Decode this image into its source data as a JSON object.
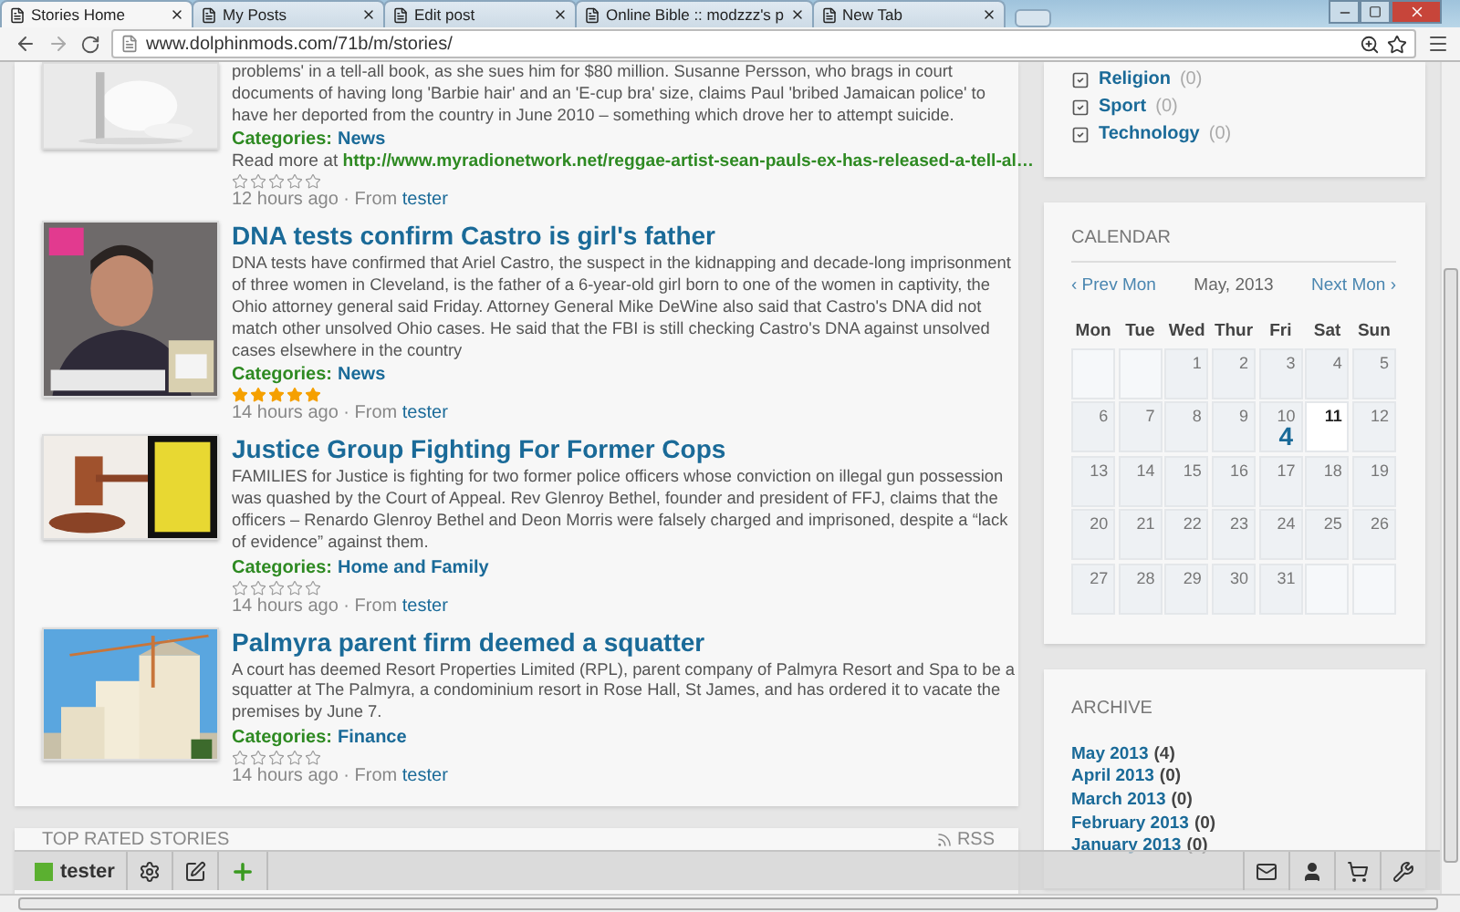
{
  "browser": {
    "tabs": [
      {
        "title": "Stories Home",
        "selected": true
      },
      {
        "title": "My Posts",
        "selected": false
      },
      {
        "title": "Edit post",
        "selected": false
      },
      {
        "title": "Online Bible :: modzzz's p",
        "selected": false
      },
      {
        "title": "New Tab",
        "selected": false
      }
    ],
    "url": "www.dolphinmods.com/71b/m/stories/"
  },
  "stories": [
    {
      "body": "problems' in a tell-all book, as she sues him for $80 million. Susanne Persson, who brags in court documents of having long 'Barbie hair' and an 'E-cup bra' size, claims Paul 'bribed Jamaican police' to have her deported from the country in June 2010 – something which drove her to attempt suicide.",
      "category_label": "Categories:",
      "category": "News",
      "read_more_label": "Read more at",
      "read_more_url": "http://www.myradionetwork.net/reggae-artist-sean-pauls-ex-has-released-a-tell-al…",
      "stars": 0,
      "meta": "12 hours ago · From",
      "author": "tester"
    },
    {
      "title": "DNA tests confirm Castro is girl's father",
      "body": "DNA tests have confirmed that Ariel Castro, the suspect in the kidnapping and decade-long imprisonment of three women in Cleveland, is the father of a 6-year-old girl born to one of the women in captivity, the Ohio attorney general said Friday. Attorney General Mike DeWine also said that Castro's DNA did not match other unsolved Ohio cases. He said that the FBI is still checking Castro's DNA against unsolved cases elsewhere in the country",
      "category_label": "Categories:",
      "category": "News",
      "stars": 5,
      "meta": "14 hours ago · From",
      "author": "tester"
    },
    {
      "title": "Justice Group Fighting For Former Cops",
      "body": "FAMILIES for Justice is fighting for two former police officers whose conviction on illegal gun possession was quashed by the Court of Appeal. Rev Glenroy Bethel, founder and president of FFJ, claims that the officers – Renardo Glenroy Bethel and Deon Morris were falsely charged and imprisoned, despite a “lack of evidence” against them.",
      "category_label": "Categories:",
      "category": "Home and Family",
      "stars": 0,
      "meta": "14 hours ago · From",
      "author": "tester"
    },
    {
      "title": "Palmyra parent firm deemed a squatter",
      "body": "A court has deemed Resort Properties Limited (RPL), parent company of Palmyra Resort and Spa to be a squatter at The Palmyra, a condominium resort in Rose Hall, St James, and has ordered it to vacate the premises by June 7.",
      "category_label": "Categories:",
      "category": "Finance",
      "stars": 0,
      "meta": "14 hours ago · From",
      "author": "tester"
    }
  ],
  "lower_panel": {
    "title": "TOP RATED STORIES",
    "rss": "RSS"
  },
  "sidebar": {
    "categories": [
      {
        "name": "Religion",
        "count": "(0)"
      },
      {
        "name": "Sport",
        "count": "(0)"
      },
      {
        "name": "Technology",
        "count": "(0)"
      }
    ],
    "calendar": {
      "title": "CALENDAR",
      "prev": "‹ Prev Mon",
      "month": "May, 2013",
      "next": "Next Mon ›",
      "weekdays": [
        "Mon",
        "Tue",
        "Wed",
        "Thur",
        "Fri",
        "Sat",
        "Sun"
      ],
      "cells": [
        {
          "kind": "blank"
        },
        {
          "kind": "blank"
        },
        {
          "kind": "day",
          "day": "1",
          "today": false
        },
        {
          "kind": "day",
          "day": "2",
          "today": false
        },
        {
          "kind": "day",
          "day": "3",
          "today": false
        },
        {
          "kind": "day",
          "day": "4",
          "today": false
        },
        {
          "kind": "day",
          "day": "5",
          "today": false
        },
        {
          "kind": "day",
          "day": "6",
          "today": false
        },
        {
          "kind": "day",
          "day": "7",
          "today": false
        },
        {
          "kind": "day",
          "day": "8",
          "today": false
        },
        {
          "kind": "day",
          "day": "9",
          "today": false
        },
        {
          "kind": "day",
          "day": "10",
          "count": "4",
          "today": false
        },
        {
          "kind": "day",
          "day": "11",
          "today": true
        },
        {
          "kind": "day",
          "day": "12",
          "today": false
        },
        {
          "kind": "day",
          "day": "13",
          "today": false
        },
        {
          "kind": "day",
          "day": "14",
          "today": false
        },
        {
          "kind": "day",
          "day": "15",
          "today": false
        },
        {
          "kind": "day",
          "day": "16",
          "today": false
        },
        {
          "kind": "day",
          "day": "17",
          "today": false
        },
        {
          "kind": "day",
          "day": "18",
          "today": false
        },
        {
          "kind": "day",
          "day": "19",
          "today": false
        },
        {
          "kind": "day",
          "day": "20",
          "today": false
        },
        {
          "kind": "day",
          "day": "21",
          "today": false
        },
        {
          "kind": "day",
          "day": "22",
          "today": false
        },
        {
          "kind": "day",
          "day": "23",
          "today": false
        },
        {
          "kind": "day",
          "day": "24",
          "today": false
        },
        {
          "kind": "day",
          "day": "25",
          "today": false
        },
        {
          "kind": "day",
          "day": "26",
          "today": false
        },
        {
          "kind": "day",
          "day": "27",
          "today": false
        },
        {
          "kind": "day",
          "day": "28",
          "today": false
        },
        {
          "kind": "day",
          "day": "29",
          "today": false
        },
        {
          "kind": "day",
          "day": "30",
          "today": false
        },
        {
          "kind": "day",
          "day": "31",
          "today": false
        },
        {
          "kind": "blank"
        },
        {
          "kind": "blank"
        }
      ]
    },
    "archive": {
      "title": "ARCHIVE",
      "items": [
        {
          "month": "May 2013",
          "count": "(4)"
        },
        {
          "month": "April 2013",
          "count": "(0)"
        },
        {
          "month": "March 2013",
          "count": "(0)"
        },
        {
          "month": "February 2013",
          "count": "(0)"
        },
        {
          "month": "January 2013",
          "count": "(0)"
        }
      ]
    }
  },
  "toolbar": {
    "user": "tester"
  }
}
